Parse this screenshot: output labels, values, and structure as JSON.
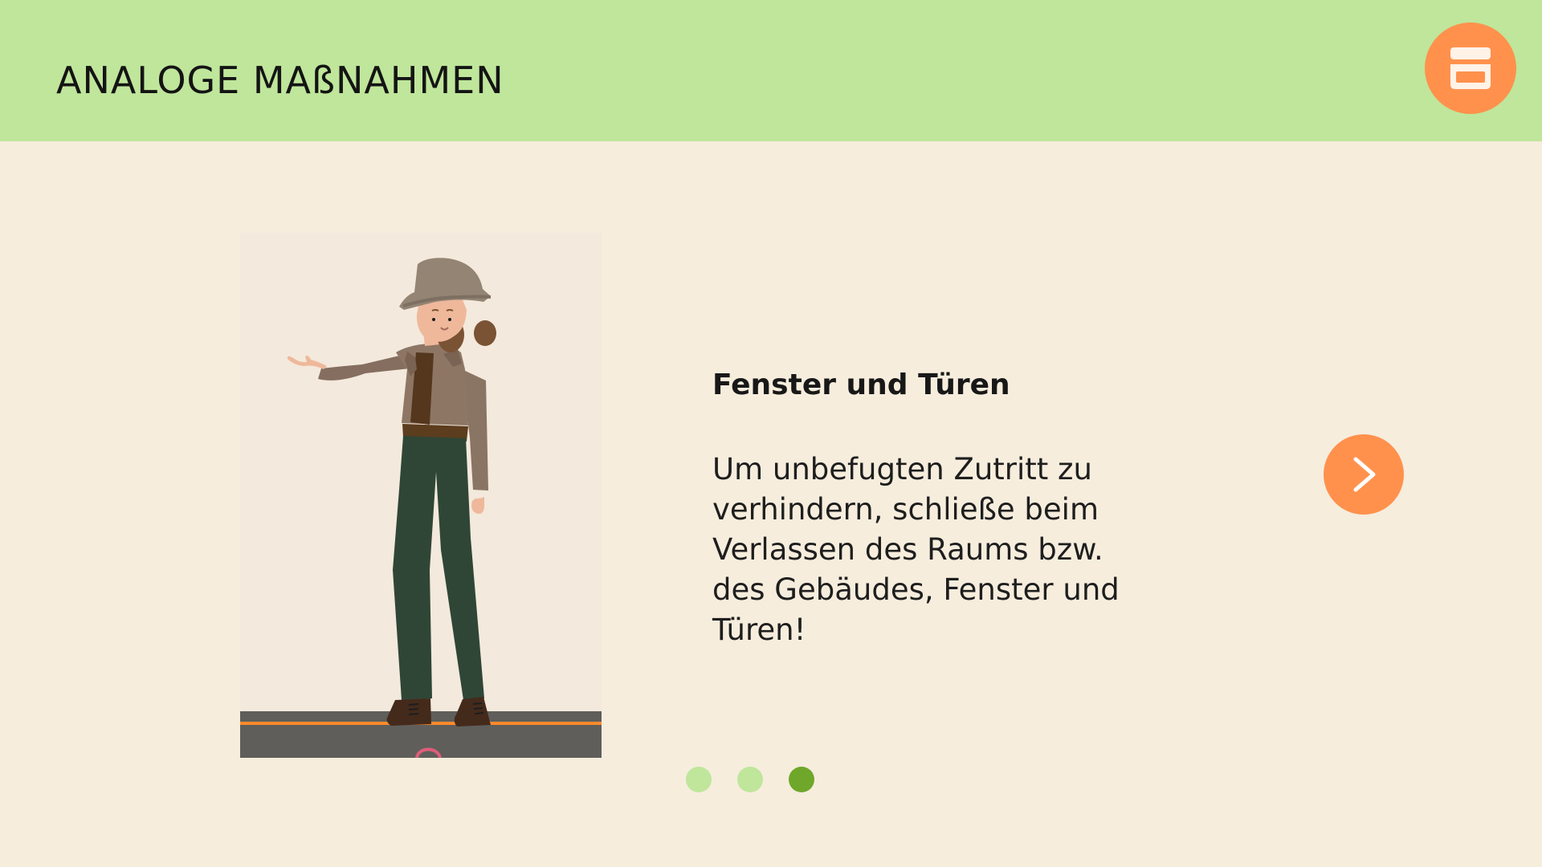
{
  "header": {
    "title": "ANALOGE MAßNAHMEN",
    "background_color": "#bfe69b",
    "menu_button_icon": "archive-box-icon"
  },
  "slide": {
    "illustration": "woman-with-hat-pointing-illustration",
    "title": "Fenster und Türen",
    "text": "Um unbefugten Zutritt zu verhindern, schließe beim Verlassen des Raums bzw. des Gebäudes, Fenster und Türen!",
    "next_button_icon": "chevron-right-icon"
  },
  "pagination": {
    "total": 3,
    "active_index": 2,
    "active_color": "#6fa72a",
    "inactive_color": "#bfe69b"
  },
  "colors": {
    "accent": "#ff914d",
    "page_background": "#f6eddd"
  }
}
